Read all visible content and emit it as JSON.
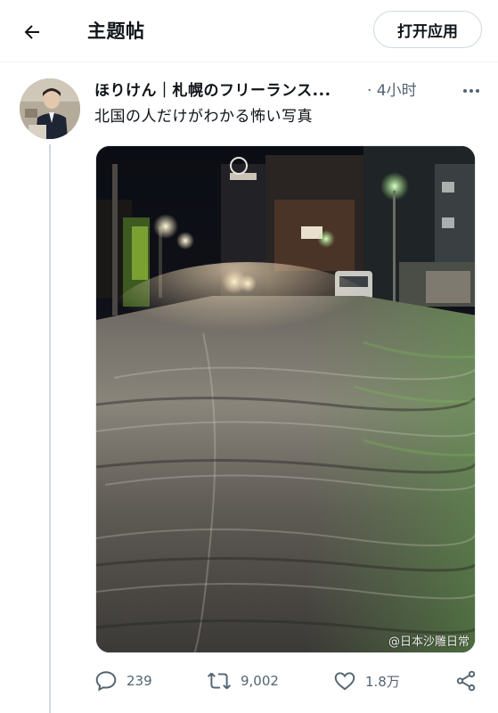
{
  "header": {
    "title": "主题帖",
    "open_app_label": "打开应用",
    "back_icon": "arrow-left-icon"
  },
  "post": {
    "author_display": "ほりけん｜札幌のフリーランス...",
    "time": "· 4小时",
    "text": "北国の人だけがわかる怖い写真",
    "avatar_icon": "user-avatar",
    "more_icon": "more-horizontal-icon"
  },
  "actions": {
    "replies": "239",
    "retweets": "9,002",
    "likes": "1.8万",
    "reply_icon": "speech-bubble-icon",
    "retweet_icon": "retweet-icon",
    "like_icon": "heart-icon",
    "share_icon": "share-icon"
  },
  "watermark": "@日本沙雕日常",
  "colors": {
    "text_primary": "#0f1419",
    "text_secondary": "#536471",
    "border": "#cfd9de"
  }
}
